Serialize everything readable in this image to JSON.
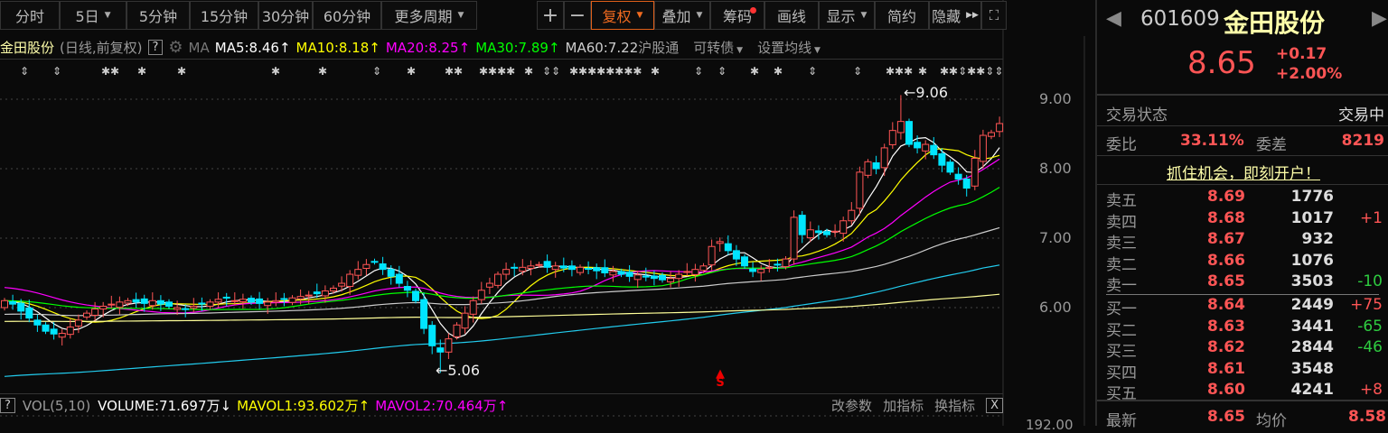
{
  "toolbar": {
    "periods": [
      "分时",
      "5日",
      "5分钟",
      "15分钟",
      "30分钟",
      "60分钟",
      "更多周期"
    ],
    "plus": "+",
    "minus": "−",
    "fuquan": "复权",
    "diejia": "叠加",
    "chouma": "筹码",
    "huaxian": "画线",
    "xianshi": "显示",
    "jianyue": "简约",
    "yincang": "隐藏"
  },
  "ma_bar": {
    "name": "金田股份",
    "mode": "(日线,前复权)",
    "help": "?",
    "ma_label": "MA",
    "ma5": "MA5:8.46",
    "ma10": "MA10:8.18",
    "ma20": "MA20:8.25",
    "ma30": "MA30:7.89",
    "ma60": "MA60:7.22",
    "up_arrow": "↑",
    "hgt": "沪股通",
    "kzz": "可转债",
    "szjx": "设置均线"
  },
  "colors": {
    "ma5": "#ffffff",
    "ma10": "#ffff00",
    "ma20": "#ff00ff",
    "ma30": "#00ff00",
    "ma60": "#cccccc",
    "ma120": "#22ccee",
    "ma250": "#ffff99",
    "up": "#ff5555",
    "down": "#00e5ff"
  },
  "chart_data": {
    "type": "candlestick",
    "ylim": [
      4.9,
      9.3
    ],
    "yticks": [
      "9.00",
      "8.00",
      "7.00",
      "6.00"
    ],
    "ytick_values": [
      9,
      8,
      7,
      6
    ],
    "max_label": "9.06",
    "min_label": "5.06",
    "max_value": 9.06,
    "min_value": 5.06,
    "signal_label": "S",
    "closes": [
      6.1,
      6.05,
      5.95,
      5.85,
      5.75,
      5.66,
      5.62,
      5.63,
      5.72,
      5.82,
      5.92,
      5.98,
      6.02,
      6.05,
      6.08,
      6.1,
      6.08,
      6.06,
      6.1,
      6.05,
      6.02,
      6.0,
      5.98,
      6.02,
      6.05,
      6.08,
      6.12,
      6.14,
      6.1,
      6.12,
      6.08,
      6.06,
      6.08,
      6.1,
      6.12,
      6.14,
      6.16,
      6.18,
      6.2,
      6.24,
      6.28,
      6.35,
      6.48,
      6.55,
      6.62,
      6.66,
      6.55,
      6.45,
      6.35,
      6.25,
      6.1,
      5.7,
      5.45,
      5.36,
      5.55,
      5.75,
      5.92,
      6.1,
      6.25,
      6.35,
      6.48,
      6.55,
      6.57,
      6.58,
      6.6,
      6.62,
      6.58,
      6.6,
      6.57,
      6.55,
      6.58,
      6.56,
      6.53,
      6.5,
      6.52,
      6.48,
      6.45,
      6.47,
      6.44,
      6.42,
      6.4,
      6.42,
      6.48,
      6.52,
      6.55,
      6.6,
      6.88,
      6.95,
      6.82,
      6.7,
      6.6,
      6.52,
      6.55,
      6.58,
      6.62,
      6.7,
      7.3,
      7.05,
      7.12,
      7.08,
      7.05,
      7.1,
      7.25,
      7.4,
      7.95,
      8.1,
      8.0,
      8.3,
      8.55,
      8.68,
      8.35,
      8.3,
      8.35,
      8.2,
      8.05,
      7.95,
      7.85,
      7.72,
      8.15,
      8.48,
      8.52,
      8.65
    ]
  },
  "volume_bar": {
    "help": "?",
    "name": "VOL(5,10)",
    "volume": "VOLUME:71.697万",
    "down_arrow": "↓",
    "mavol1": "MAVOL1:93.602万",
    "mavol2": "MAVOL2:70.464万",
    "up_arrow": "↑",
    "gcs": "改参数",
    "jzb": "加指标",
    "hzb": "换指标",
    "close": "X",
    "axis_value": "192.00"
  },
  "quote": {
    "code": "601609",
    "name": "金田股份",
    "price": "8.65",
    "change": "+0.17",
    "change_pct": "+2.00%",
    "status_label": "交易状态",
    "status": "交易中",
    "wb_label": "委比",
    "wb": "33.11%",
    "wc_label": "委差",
    "wc": "8219",
    "banner": "抓住机会，即刻开户！",
    "asks": [
      {
        "label": "卖五",
        "price": "8.69",
        "vol": "1776",
        "chg": ""
      },
      {
        "label": "卖四",
        "price": "8.68",
        "vol": "1017",
        "chg": "+1"
      },
      {
        "label": "卖三",
        "price": "8.67",
        "vol": "932",
        "chg": ""
      },
      {
        "label": "卖二",
        "price": "8.66",
        "vol": "1076",
        "chg": ""
      },
      {
        "label": "卖一",
        "price": "8.65",
        "vol": "3503",
        "chg": "-10"
      }
    ],
    "bids": [
      {
        "label": "买一",
        "price": "8.64",
        "vol": "2449",
        "chg": "+75"
      },
      {
        "label": "买二",
        "price": "8.63",
        "vol": "3441",
        "chg": "-65"
      },
      {
        "label": "买三",
        "price": "8.62",
        "vol": "2844",
        "chg": "-46"
      },
      {
        "label": "买四",
        "price": "8.61",
        "vol": "3548",
        "chg": ""
      },
      {
        "label": "买五",
        "price": "8.60",
        "vol": "4241",
        "chg": "+8"
      }
    ],
    "last_label": "最新",
    "last": "8.65",
    "avg_label": "均价",
    "avg": "8.58"
  }
}
